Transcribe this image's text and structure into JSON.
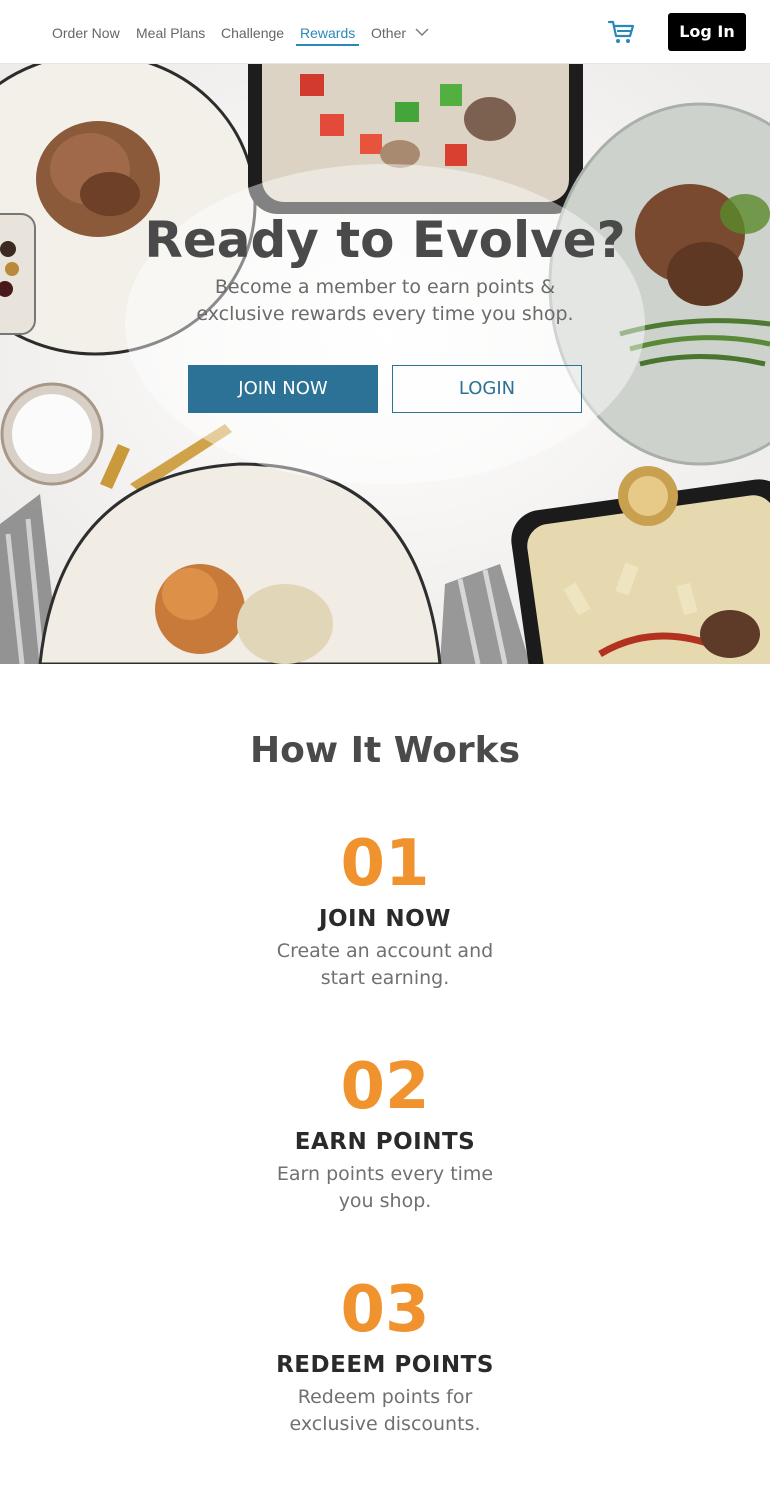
{
  "nav": {
    "links": [
      {
        "label": "Order Now"
      },
      {
        "label": "Meal Plans"
      },
      {
        "label": "Challenge"
      },
      {
        "label": "Rewards",
        "active": true
      },
      {
        "label": "Other"
      }
    ],
    "cart_icon": "cart-icon",
    "login_label": "Log In"
  },
  "hero": {
    "title": "Ready to Evolve?",
    "subtitle": "Become a member to earn points & exclusive rewards every time you shop.",
    "join_label": "JOIN NOW",
    "login_label": "LOGIN"
  },
  "how": {
    "title": "How It Works",
    "steps": [
      {
        "number": "01",
        "title": "JOIN NOW",
        "description": "Create an account and start earning."
      },
      {
        "number": "02",
        "title": "EARN POINTS",
        "description": "Earn points every time you shop."
      },
      {
        "number": "03",
        "title": "REDEEM POINTS",
        "description": "Redeem points for exclusive discounts."
      }
    ]
  },
  "colors": {
    "accent_blue": "#2b7296",
    "nav_active": "#2a88b8",
    "step_orange": "#f0922e"
  }
}
